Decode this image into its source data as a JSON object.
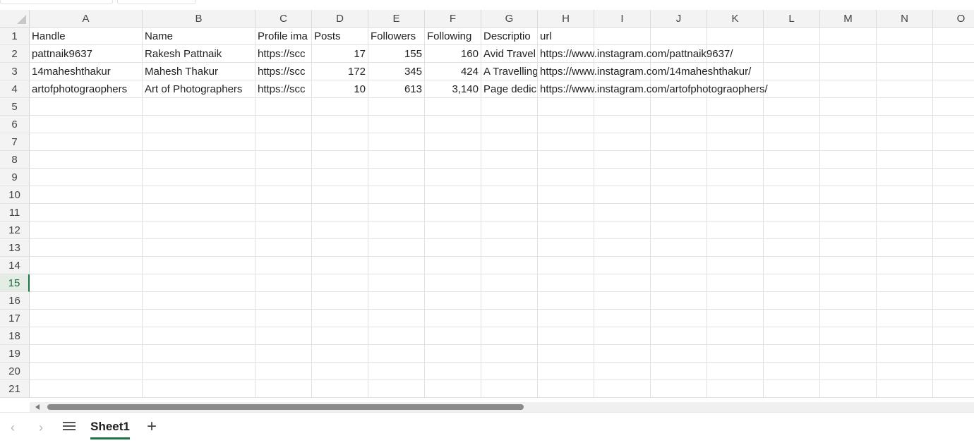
{
  "columns": [
    "A",
    "B",
    "C",
    "D",
    "E",
    "F",
    "G",
    "H",
    "I",
    "J",
    "K",
    "L",
    "M",
    "N",
    "O"
  ],
  "rows": [
    "1",
    "2",
    "3",
    "4",
    "5",
    "6",
    "7",
    "8",
    "9",
    "10",
    "11",
    "12",
    "13",
    "14",
    "15",
    "16",
    "17",
    "18",
    "19",
    "20",
    "21"
  ],
  "active_row": "15",
  "header": {
    "handle": "Handle",
    "name": "Name",
    "profile_image": "Profile ima",
    "posts": "Posts",
    "followers": "Followers",
    "following": "Following",
    "description": "Descriptio",
    "url": "url"
  },
  "records": [
    {
      "handle": "pattnaik9637",
      "name": "Rakesh Pattnaik",
      "profile_image": "https://scc",
      "posts": "17",
      "followers": "155",
      "following": "160",
      "description": "Avid Travel",
      "url": "https://www.instagram.com/pattnaik9637/"
    },
    {
      "handle": "14maheshthakur",
      "name": "Mahesh Thakur",
      "profile_image": "https://scc",
      "posts": "172",
      "followers": "345",
      "following": "424",
      "description": "A Travelling",
      "url": "https://www.instagram.com/14maheshthakur/"
    },
    {
      "handle": "artofphotograophers",
      "name": "Art of Photographers",
      "profile_image": "https://scc",
      "posts": "10",
      "followers": "613",
      "following": "3,140",
      "description": "Page dedic",
      "url": "https://www.instagram.com/artofphotograophers/"
    }
  ],
  "sheet_tab": "Sheet1",
  "icons": {
    "prev": "chevron-left-icon",
    "next": "chevron-right-icon",
    "menu": "hamburger-icon",
    "add": "plus-icon"
  },
  "colors": {
    "accent": "#1e7145",
    "header_bg": "#f3f3f3",
    "gridline": "#e1e1e1"
  }
}
